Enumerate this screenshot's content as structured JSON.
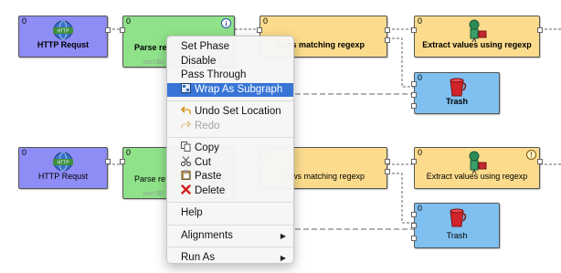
{
  "graph": {
    "row1": {
      "http": {
        "num": "0",
        "label": "HTTP Requst",
        "icon": "http-globe-icon"
      },
      "parse": {
        "num": "0",
        "label": "Parse re",
        "sub": "port:$0",
        "icon": "parse-document-icon"
      },
      "filter": {
        "num": "0",
        "label": "rows matching regexp"
      },
      "extract": {
        "num": "0",
        "label": "Extract values using regexp",
        "icon": "extract-robot-icon"
      },
      "trash": {
        "num": "0",
        "label": "Trash",
        "icon": "trash-bucket-icon"
      }
    },
    "row2": {
      "http": {
        "num": "0",
        "label": "HTTP Requst",
        "icon": "http-globe-icon"
      },
      "parse": {
        "num": "0",
        "label": "Parse re",
        "sub": "port:$0",
        "icon": "parse-document-icon"
      },
      "filter": {
        "num": "0",
        "label": "rows matching regexp"
      },
      "extract": {
        "num": "0",
        "label": "Extract values using regexp",
        "icon": "extract-robot-icon"
      },
      "trash": {
        "num": "0",
        "label": "Trash",
        "icon": "trash-bucket-icon"
      }
    }
  },
  "menu": {
    "set_phase": "Set Phase",
    "disable": "Disable",
    "pass_through": "Pass Through",
    "wrap_subgraph": "Wrap As Subgraph",
    "undo": "Undo Set Location",
    "redo": "Redo",
    "copy": "Copy",
    "cut": "Cut",
    "paste": "Paste",
    "delete": "Delete",
    "help": "Help",
    "alignments": "Alignments",
    "run_as": "Run As"
  },
  "colors": {
    "http_node": "#8e8cf5",
    "parse_node": "#8fe28a",
    "filter_node": "#fcdc8c",
    "trash_node": "#7fc0f0",
    "menu_highlight": "#3875d7"
  }
}
